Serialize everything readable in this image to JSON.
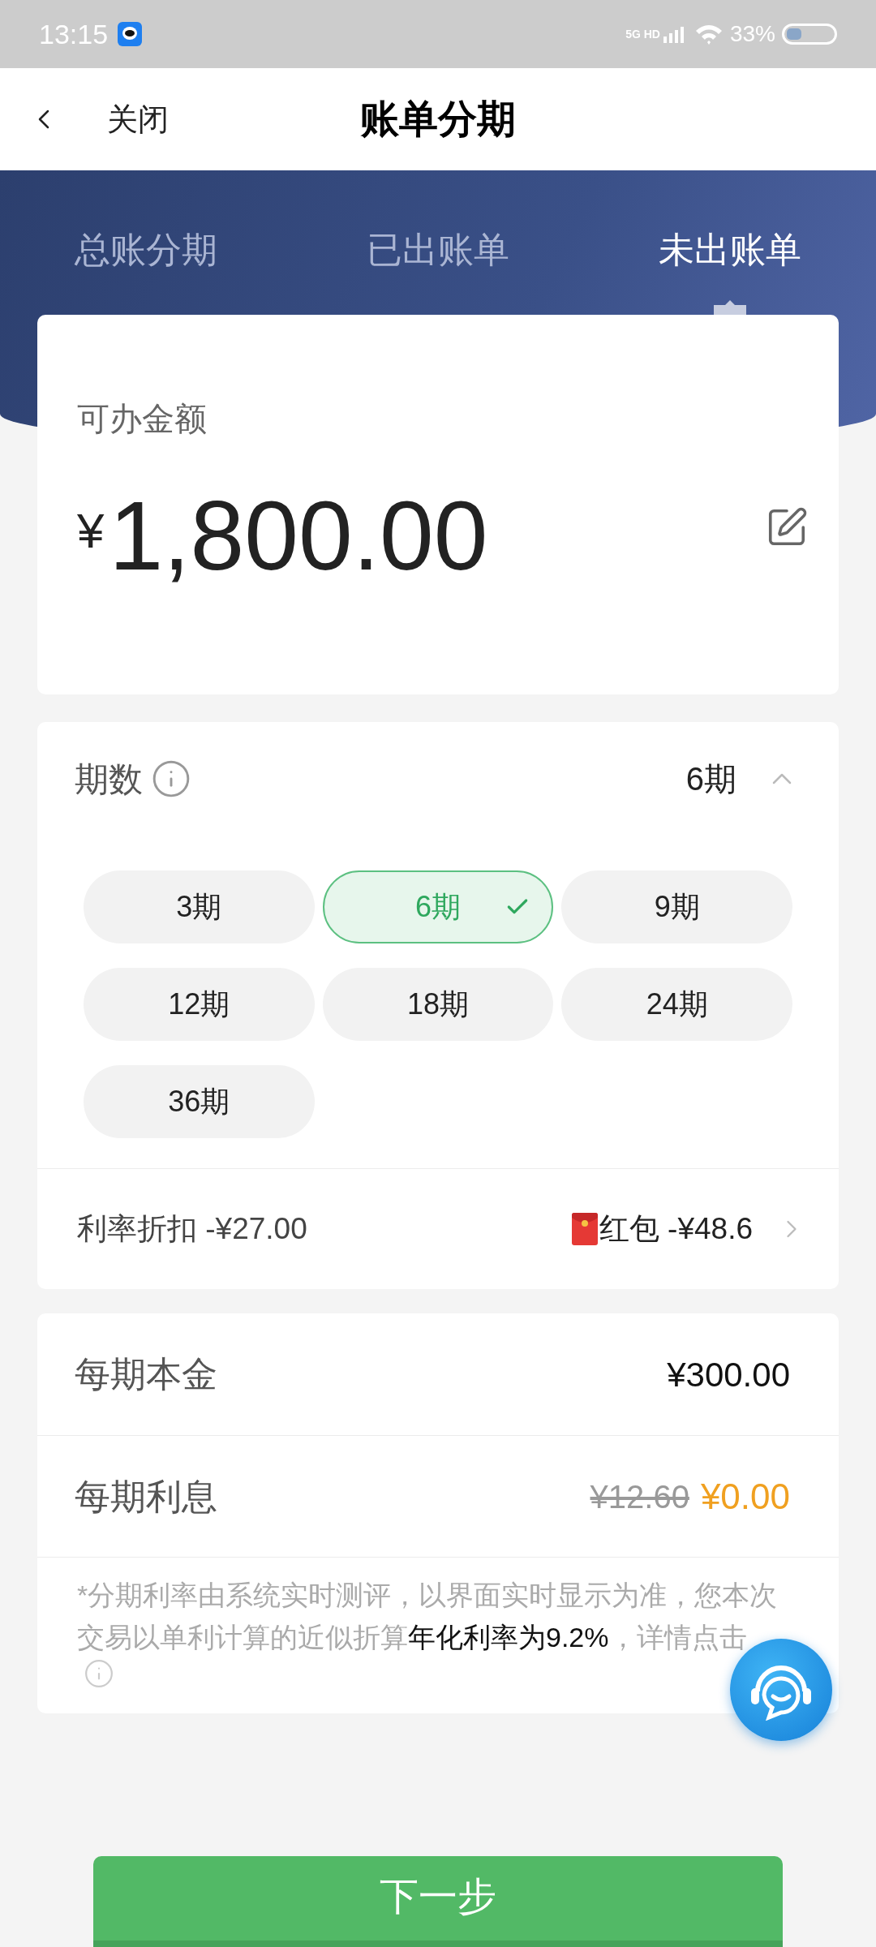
{
  "status_bar": {
    "time": "13:15",
    "network": "5G HD",
    "battery": "33%"
  },
  "header": {
    "back_label": "关闭",
    "title": "账单分期"
  },
  "tabs": [
    {
      "label": "总账分期",
      "selected": false
    },
    {
      "label": "已出账单",
      "selected": false
    },
    {
      "label": "未出账单",
      "selected": true
    }
  ],
  "amount_card": {
    "label": "可办金额",
    "currency": "¥",
    "amount": "1,800.00"
  },
  "terms": {
    "label": "期数",
    "value": "6期",
    "expanded": true,
    "options": [
      {
        "label": "3期",
        "selected": false
      },
      {
        "label": "6期",
        "selected": true
      },
      {
        "label": "9期",
        "selected": false
      },
      {
        "label": "12期",
        "selected": false
      },
      {
        "label": "18期",
        "selected": false
      },
      {
        "label": "24期",
        "selected": false
      },
      {
        "label": "36期",
        "selected": false
      }
    ]
  },
  "discounts": {
    "rate_discount": "利率折扣 -¥27.00",
    "red_packet": "红包 -¥48.6"
  },
  "rows": [
    {
      "kind": "plain",
      "label": "每期本金",
      "value": "¥300.00"
    },
    {
      "kind": "discounted",
      "label": "每期利息",
      "original": "¥12.60",
      "value": "¥0.00"
    }
  ],
  "note": {
    "before": "*分期利率由系统实时测评，以界面实时显示为准，您本次交易以单利计算的近似折算",
    "highlight": "年化利率为9.2%",
    "after": "，详情点击"
  },
  "next_button": "下一步"
}
